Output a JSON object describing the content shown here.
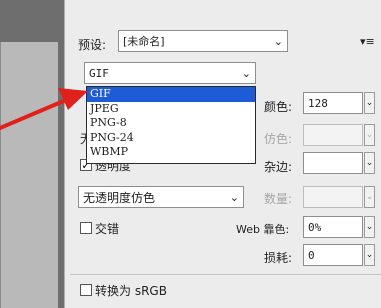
{
  "preset": {
    "label": "预设:",
    "value": "[未命名]"
  },
  "format_select": {
    "value": "GIF"
  },
  "format_options": [
    "GIF",
    "JPEG",
    "PNG-8",
    "PNG-24",
    "WBMP"
  ],
  "colors": {
    "label": "颜色:",
    "value": "128"
  },
  "dither_right": {
    "label": "仿色:"
  },
  "partial_label_left": "无",
  "transparency": {
    "label": "透明度",
    "checked": true
  },
  "matte": {
    "label": "杂边:"
  },
  "transparency_dither": {
    "value": "无透明度仿色"
  },
  "amount": {
    "label": "数量:"
  },
  "interlace": {
    "label": "交错",
    "checked": false
  },
  "web_snap": {
    "label": "Web 靠色:",
    "value": "0%"
  },
  "lossy": {
    "label": "损耗:",
    "value": "0"
  },
  "convert_srgb": {
    "label": "转换为 sRGB",
    "checked": false
  },
  "menu_icon_name": "panel-menu-icon",
  "arrow_color": "#e0201a",
  "selection_color": "#1e5bd6"
}
